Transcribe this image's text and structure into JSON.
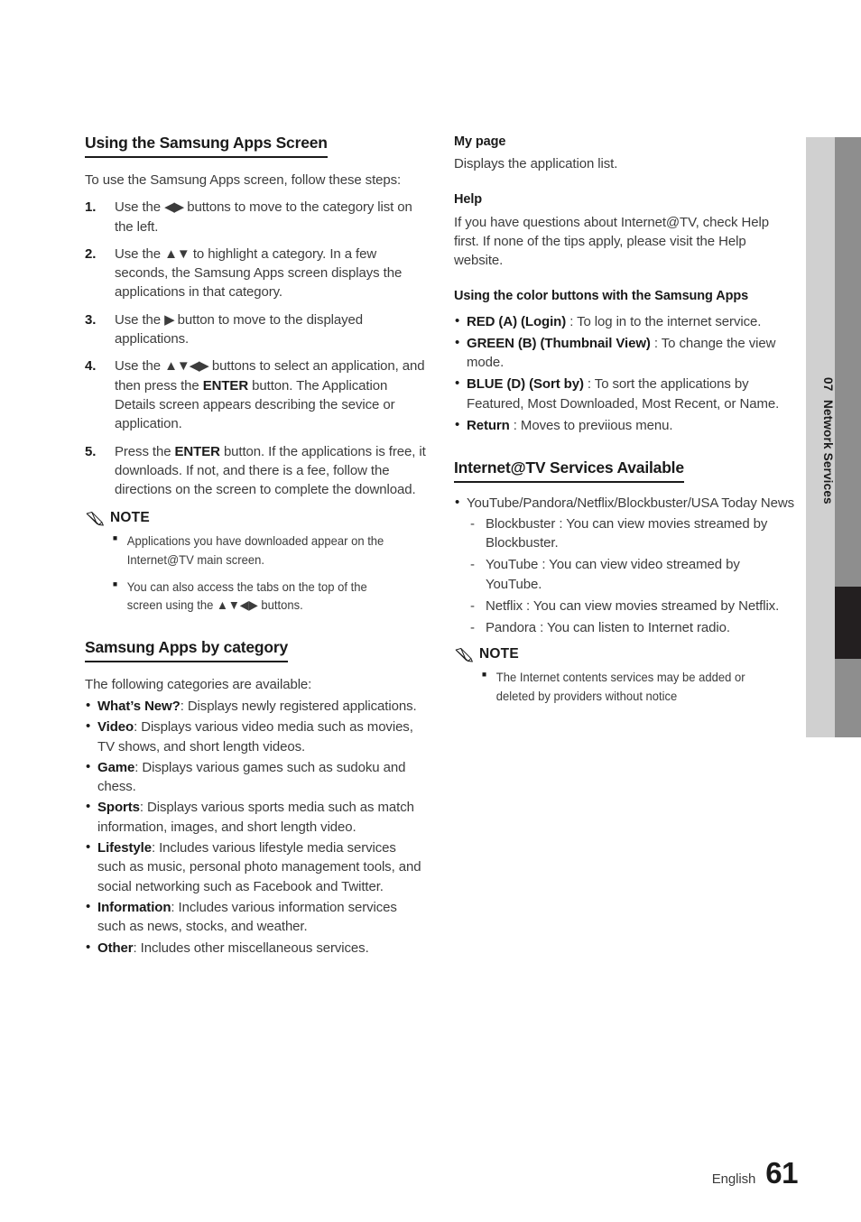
{
  "chapter_tab": {
    "number": "07",
    "title": "Network Services",
    "colors": {
      "light_strip": "#d0d0d0",
      "dark_strip": "#8e8e8e",
      "marker": "#231f20"
    }
  },
  "footer": {
    "language": "English",
    "page_number": "61"
  },
  "left_column": {
    "heading": "Using the Samsung Apps Screen",
    "intro": "To use the Samsung Apps screen, follow these steps:",
    "steps": [
      {
        "num": "1.",
        "text_parts": [
          "Use the ",
          "◀▶",
          " buttons to move to the category list on the left."
        ]
      },
      {
        "num": "2.",
        "text_parts": [
          "Use the ",
          "▲▼",
          " to highlight a category. In a few seconds, the Samsung Apps screen displays the applications in that category."
        ]
      },
      {
        "num": "3.",
        "text_parts": [
          "Use the ",
          "▶",
          " button to move to the displayed applications."
        ]
      },
      {
        "num": "4.",
        "text_parts": [
          "Use the ",
          "▲▼◀▶",
          " buttons to select an application, and then press the ",
          "ENTER",
          " button. The Application Details screen appears describing the sevice or application."
        ]
      },
      {
        "num": "5.",
        "text_parts": [
          "Press the ",
          "ENTER",
          " button. If the applications is free, it downloads. If not, and there is a fee, follow the directions on the screen to complete the download."
        ]
      }
    ],
    "note": {
      "label": "NOTE",
      "items": [
        "Applications you have downloaded appear on the Internet@TV main screen.",
        "You can also access the tabs on the top of the screen using the ▲▼◀▶ buttons."
      ]
    },
    "category_heading": "Samsung Apps by category",
    "category_intro": "The following categories are available:",
    "categories": [
      {
        "term": "What’s New?",
        "desc": ": Displays newly registered applications."
      },
      {
        "term": "Video",
        "desc": ": Displays various video media such as movies, TV shows, and short length videos."
      },
      {
        "term": "Game",
        "desc": ": Displays various games such as sudoku and chess."
      },
      {
        "term": "Sports",
        "desc": ": Displays various sports media such as match information, images, and short length video."
      },
      {
        "term": "Lifestyle",
        "desc": ": Includes various lifestyle media services such as music, personal photo management tools, and social networking such as Facebook and Twitter."
      },
      {
        "term": "Information",
        "desc": ": Includes various information services such as news, stocks, and weather."
      },
      {
        "term": "Other",
        "desc": ": Includes other miscellaneous services."
      }
    ]
  },
  "right_column": {
    "my_page": {
      "heading": "My page",
      "body": "Displays the application list."
    },
    "help": {
      "heading": "Help",
      "body": "If you have questions about Internet@TV, check Help first. If none of the tips apply, please visit the Help website."
    },
    "color_buttons": {
      "heading": "Using the color buttons with the Samsung Apps",
      "items": [
        {
          "term": "RED (A) (Login)",
          "desc": " : To log in to the internet service."
        },
        {
          "term": "GREEN (B) (Thumbnail View)",
          "desc": " : To change the view mode."
        },
        {
          "term": "BLUE (D) (Sort by)",
          "desc": " : To sort the applications by Featured, Most Downloaded, Most Recent, or Name."
        },
        {
          "term": "Return",
          "desc": " : Moves to previious menu."
        }
      ]
    },
    "services": {
      "heading": "Internet@TV Services Available",
      "bullet": "YouTube/Pandora/Netflix/Blockbuster/USA Today News",
      "sub_items": [
        "Blockbuster : You can view movies streamed by Blockbuster.",
        "YouTube : You can view video streamed by YouTube.",
        "Netflix : You can view movies streamed by Netflix.",
        "Pandora : You can listen to Internet radio."
      ],
      "note": {
        "label": "NOTE",
        "items": [
          "The Internet contents services may be added or deleted by providers without notice"
        ]
      }
    }
  }
}
